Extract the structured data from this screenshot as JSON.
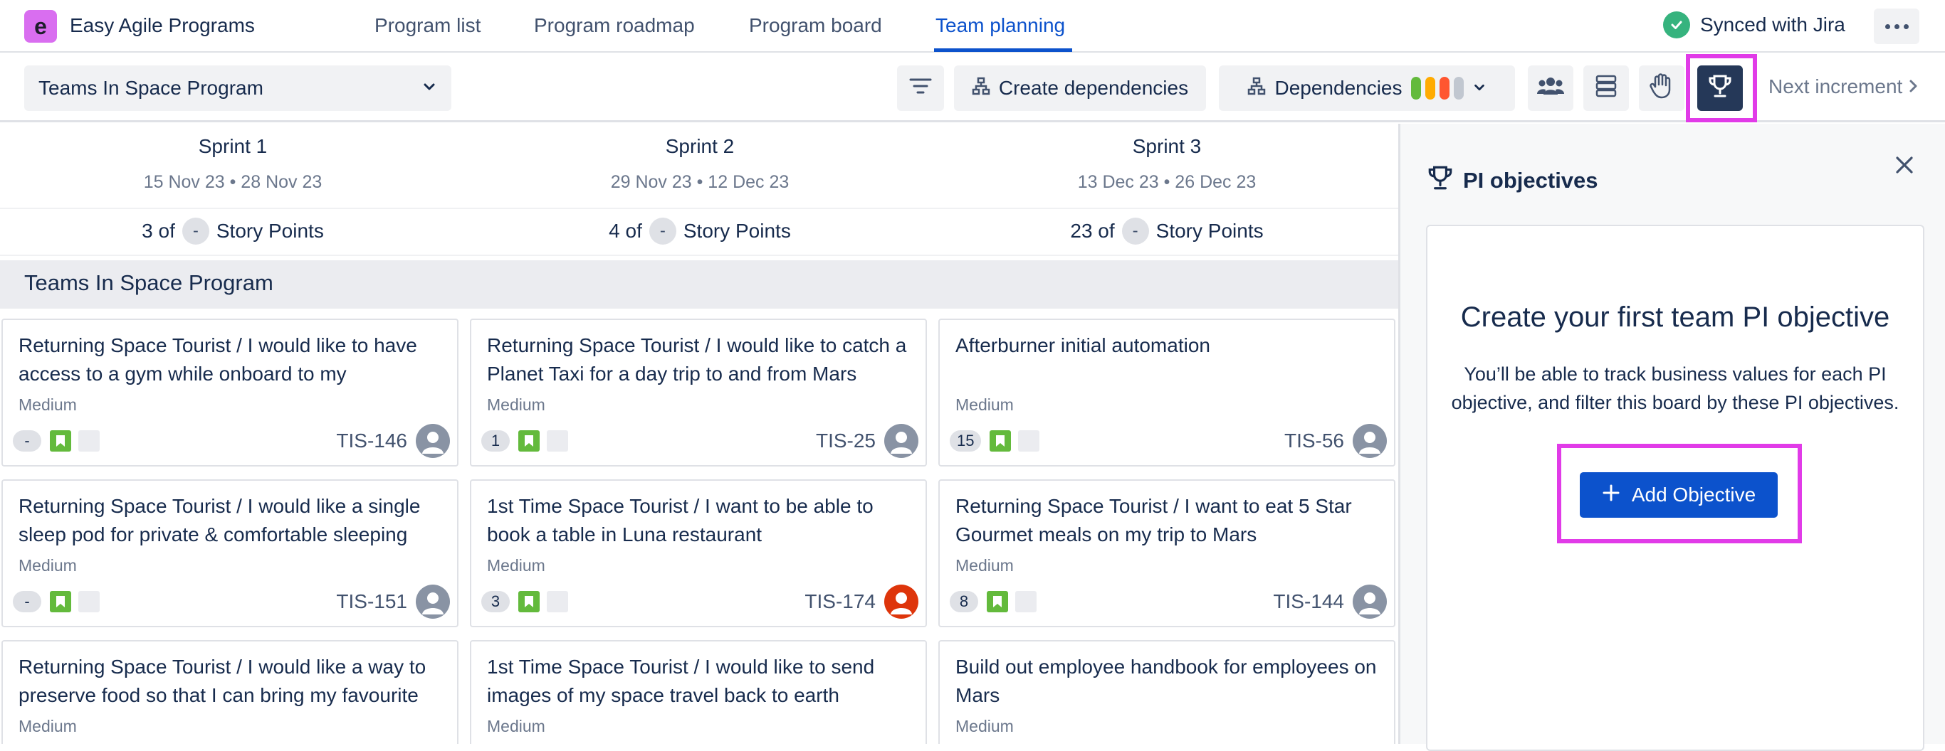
{
  "app": {
    "title": "Easy Agile Programs",
    "logo_letter": "e"
  },
  "nav": {
    "tabs": [
      {
        "label": "Program list"
      },
      {
        "label": "Program roadmap"
      },
      {
        "label": "Program board"
      },
      {
        "label": "Team planning",
        "active": true
      }
    ],
    "sync_status": "Synced with Jira"
  },
  "toolbar": {
    "program_select": "Teams In Space Program",
    "create_dependencies": "Create dependencies",
    "dependencies": "Dependencies",
    "dependency_colors": [
      "#63ba3c",
      "#ffab00",
      "#ff5630",
      "#c1c7d0"
    ],
    "next_increment": "Next increment"
  },
  "sprints": [
    {
      "name": "Sprint 1",
      "dates": "15 Nov 23 • 28 Nov 23",
      "points_prefix": "3 of",
      "points_value": "-",
      "points_suffix": "Story Points"
    },
    {
      "name": "Sprint 2",
      "dates": "29 Nov 23 • 12 Dec 23",
      "points_prefix": "4 of",
      "points_value": "-",
      "points_suffix": "Story Points"
    },
    {
      "name": "Sprint 3",
      "dates": "13 Dec 23 • 26 Dec 23",
      "points_prefix": "23 of",
      "points_value": "-",
      "points_suffix": "Story Points"
    }
  ],
  "group": {
    "title": "Teams In Space Program"
  },
  "cards": [
    {
      "title": "Returning Space Tourist / I would like to have access to a gym while onboard to my",
      "priority": "Medium",
      "estimate": "-",
      "key": "TIS-146"
    },
    {
      "title": "Returning Space Tourist / I would like to catch a Planet Taxi for a day trip to and from Mars",
      "priority": "Medium",
      "estimate": "1",
      "key": "TIS-25"
    },
    {
      "title": "Afterburner initial automation",
      "priority": "Medium",
      "estimate": "15",
      "key": "TIS-56"
    },
    {
      "title": "Returning Space Tourist / I would like a single sleep pod for private & comfortable sleeping",
      "priority": "Medium",
      "estimate": "-",
      "key": "TIS-151"
    },
    {
      "title": "1st Time Space Tourist / I want to be able to book a table in Luna restaurant",
      "priority": "Medium",
      "estimate": "3",
      "key": "TIS-174"
    },
    {
      "title": "Returning Space Tourist / I want to eat 5 Star Gourmet meals on my trip to Mars",
      "priority": "Medium",
      "estimate": "8",
      "key": "TIS-144"
    },
    {
      "title": "Returning Space Tourist / I would like a way to preserve food so that I can bring my favourite",
      "priority": "Medium"
    },
    {
      "title": "1st Time Space Tourist / I would like to send images of my space travel back to earth",
      "priority": "Medium"
    },
    {
      "title": "Build out employee handbook for employees on Mars",
      "priority": "Medium"
    }
  ],
  "panel": {
    "title": "PI objectives",
    "heading": "Create your first team PI objective",
    "description": "You’ll be able to track business values for each PI objective, and filter this board by these PI objectives.",
    "add_button": "Add Objective"
  }
}
